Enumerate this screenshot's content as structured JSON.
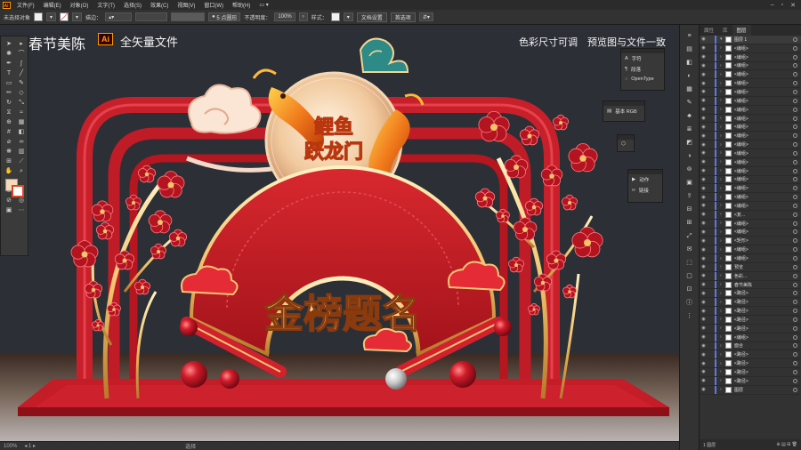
{
  "menu": {
    "logo": "Ai",
    "items": [
      "文件(F)",
      "编辑(E)",
      "对象(O)",
      "文字(T)",
      "选择(S)",
      "效果(C)",
      "视图(V)",
      "窗口(W)",
      "帮助(H)"
    ]
  },
  "control_bar": {
    "selection": "未选择对象",
    "stroke_label": "描边：",
    "brush": "5 点圆形",
    "brush_prefix": "●",
    "opacity_label": "不透明度：",
    "opacity_value": "100%",
    "style_label": "样式：",
    "doc_settings": "文档设置",
    "prefs": "首选项"
  },
  "overlay": {
    "title_left": "春节美陈",
    "ai_badge": "Ai",
    "title_sub": "全矢量文件",
    "note1": "色彩尺寸可调",
    "note2": "预览图与文件一致"
  },
  "artwork": {
    "badge_line1": "鲤鱼",
    "badge_line2": "跃龙门",
    "banner": "金榜题名"
  },
  "panels": {
    "char": [
      "字符",
      "段落",
      "OpenType"
    ],
    "color": "基本 RGB",
    "actions": [
      "动作",
      "链接"
    ]
  },
  "layers": {
    "tabs": [
      "属性",
      "库",
      "图层"
    ],
    "rows": [
      "图层 1",
      "<编组>",
      "<编组>",
      "<编组>",
      "<编组>",
      "<编组>",
      "<编组>",
      "<编组>",
      "<编组>",
      "<编组>",
      "<编组>",
      "<编组>",
      "<编组>",
      "<编组>",
      "<编组>",
      "<编组>",
      "<编组>",
      "<编组>",
      "<编组>",
      "<编组>",
      "<复...",
      "<编组>",
      "<编组>",
      "<矩形>",
      "<编组>",
      "<编组>",
      "预览",
      "色彩...",
      "春节美陈",
      "<路径>",
      "<路径>",
      "<路径>",
      "<路径>",
      "<路径>",
      "<编组>",
      "面合",
      "<路径>",
      "<路径>",
      "<路径>",
      "<路径>",
      "图层"
    ],
    "footer": "1 图层"
  },
  "status": {
    "zoom": "100%",
    "mode": "选择"
  },
  "colors": {
    "red": "#c8202b",
    "dark_red": "#8d0f18",
    "gold": "#f2c777",
    "bg": "#2d2f36",
    "stage_floor": "#a01b22"
  }
}
